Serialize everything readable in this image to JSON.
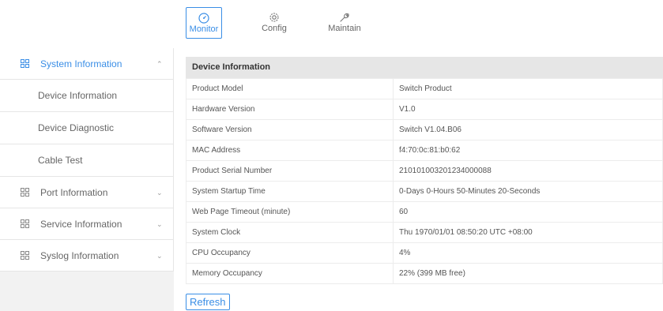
{
  "topnav": {
    "items": [
      {
        "label": "Monitor",
        "icon": "gauge-icon",
        "active": true
      },
      {
        "label": "Config",
        "icon": "gear-icon"
      },
      {
        "label": "Maintain",
        "icon": "wrench-icon"
      }
    ]
  },
  "sidebar": {
    "system": {
      "label": "System Information",
      "icon": "grid-icon",
      "expanded": true,
      "subitems": [
        "Device Information",
        "Device Diagnostic",
        "Cable Test"
      ]
    },
    "port": {
      "label": "Port Information",
      "icon": "grid-icon"
    },
    "service": {
      "label": "Service Information",
      "icon": "grid-icon"
    },
    "syslog": {
      "label": "Syslog Information",
      "icon": "grid-icon"
    }
  },
  "panel": {
    "title": "Device Information",
    "rows": [
      {
        "key": "Product Model",
        "value": "Switch Product"
      },
      {
        "key": "Hardware Version",
        "value": "V1.0"
      },
      {
        "key": "Software Version",
        "value": "Switch V1.04.B06"
      },
      {
        "key": "MAC Address",
        "value": "f4:70:0c:81:b0:62"
      },
      {
        "key": "Product Serial Number",
        "value": "210101003201234000088"
      },
      {
        "key": "System Startup Time",
        "value": "0-Days 0-Hours 50-Minutes 20-Seconds"
      },
      {
        "key": "Web Page Timeout (minute)",
        "value": "60"
      },
      {
        "key": "System Clock",
        "value": "Thu 1970/01/01 08:50:20 UTC +08:00"
      },
      {
        "key": "CPU Occupancy",
        "value": "4%"
      },
      {
        "key": "Memory Occupancy",
        "value": "22% (399 MB free)"
      }
    ],
    "refresh_label": "Refresh"
  },
  "colors": {
    "accent": "#3a8ee6",
    "header_bg": "#e6e6e6",
    "sidebar_bg": "#f2f2f2"
  }
}
